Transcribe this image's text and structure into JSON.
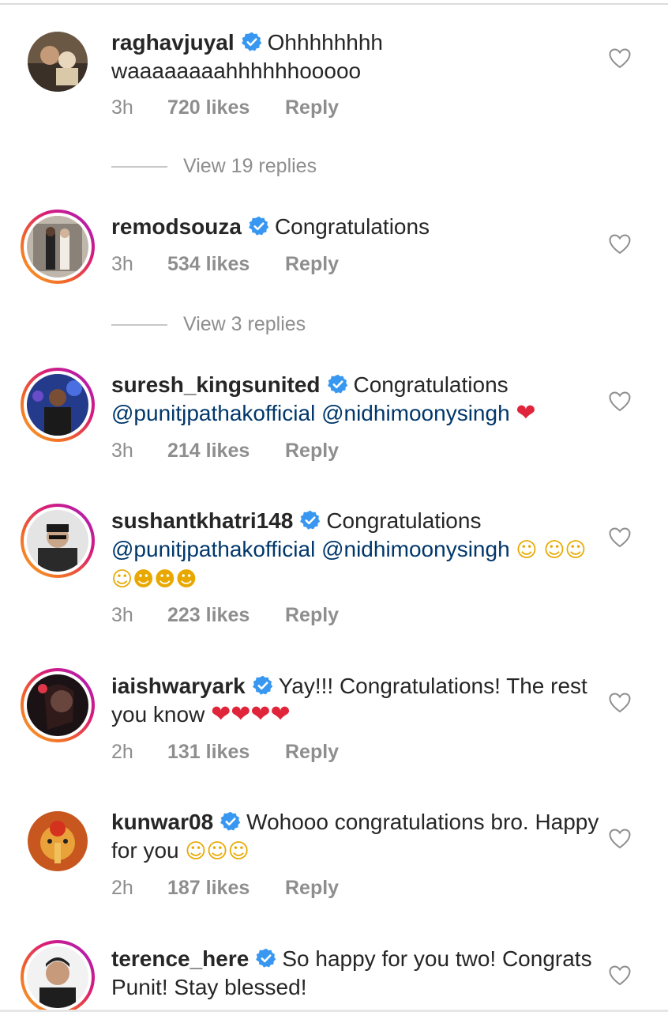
{
  "comments": [
    {
      "username": "raghavjuyal",
      "text": "Ohhhhhhhh waaaaaaaahhhhhhooooo",
      "time": "3h",
      "likes": "720 likes",
      "reply": "Reply",
      "verified": true,
      "avatar_icon": "avatar-photo"
    },
    {
      "username": "remodsouza",
      "text": "Congratulations",
      "time": "3h",
      "likes": "534 likes",
      "reply": "Reply",
      "verified": true,
      "avatar_icon": "avatar-photo"
    },
    {
      "username": "suresh_kingsunited",
      "text": "Congratulations",
      "mention1": "@punitjpathakofficial",
      "mention2": "@nidhimoonysingh",
      "emoji": "❤",
      "time": "3h",
      "likes": "214 likes",
      "reply": "Reply",
      "verified": true,
      "avatar_icon": "avatar-photo"
    },
    {
      "username": "sushantkhatri148",
      "text": "Congratulations",
      "mention1": "@punitjpathakofficial",
      "mention2": "@nidhimoonysingh",
      "emoji1": "☺",
      "emoji2": "☺☺☺☻☻☻",
      "time": "3h",
      "likes": "223 likes",
      "reply": "Reply",
      "verified": true,
      "avatar_icon": "avatar-photo"
    },
    {
      "username": "iaishwaryark",
      "text": "Yay!!! Congratulations! The rest you know",
      "emoji": "❤❤❤❤",
      "time": "2h",
      "likes": "131 likes",
      "reply": "Reply",
      "verified": true,
      "avatar_icon": "avatar-photo"
    },
    {
      "username": "kunwar08",
      "text": "Wohooo congratulations bro. Happy for you",
      "emoji": "☺☺☺",
      "time": "2h",
      "likes": "187 likes",
      "reply": "Reply",
      "verified": true,
      "avatar_icon": "avatar-photo"
    },
    {
      "username": "terence_here",
      "text": "So happy for you two! Congrats Punit! Stay blessed!",
      "verified": true,
      "avatar_icon": "avatar-photo"
    }
  ],
  "view_replies": [
    {
      "label": "View 19 replies"
    },
    {
      "label": "View 3 replies"
    }
  ],
  "colors": {
    "text": "#262626",
    "secondary": "#8e8e8e",
    "mention": "#00376b",
    "verified": "#3897f0",
    "story_ring": [
      "#f9a825",
      "#f0622b",
      "#d81b79",
      "#a020c8"
    ]
  },
  "icons": {
    "like": "heart-outline-icon",
    "verified": "verified-badge-icon"
  }
}
